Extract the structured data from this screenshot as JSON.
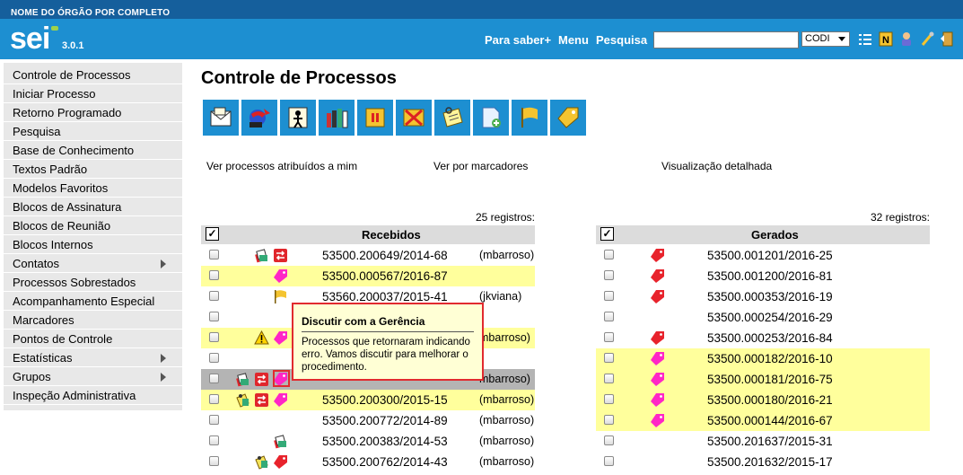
{
  "org_name": "NOME DO ÓRGÃO POR COMPLETO",
  "header": {
    "logo": "sei",
    "version": "3.0.1",
    "links": [
      "Para saber+",
      "Menu",
      "Pesquisa"
    ],
    "search_value": "",
    "org_select": "CODI",
    "icons": [
      "list-icon",
      "notes-icon",
      "user-icon",
      "tools-icon",
      "exit-icon"
    ]
  },
  "sidebar": {
    "items": [
      {
        "label": "Controle de Processos",
        "submenu": false
      },
      {
        "label": "Iniciar Processo",
        "submenu": false
      },
      {
        "label": "Retorno Programado",
        "submenu": false
      },
      {
        "label": "Pesquisa",
        "submenu": false
      },
      {
        "label": "Base de Conhecimento",
        "submenu": false
      },
      {
        "label": "Textos Padrão",
        "submenu": false
      },
      {
        "label": "Modelos Favoritos",
        "submenu": false
      },
      {
        "label": "Blocos de Assinatura",
        "submenu": false
      },
      {
        "label": "Blocos de Reunião",
        "submenu": false
      },
      {
        "label": "Blocos Internos",
        "submenu": false
      },
      {
        "label": "Contatos",
        "submenu": true
      },
      {
        "label": "Processos Sobrestados",
        "submenu": false
      },
      {
        "label": "Acompanhamento Especial",
        "submenu": false
      },
      {
        "label": "Marcadores",
        "submenu": false
      },
      {
        "label": "Pontos de Controle",
        "submenu": false
      },
      {
        "label": "Estatísticas",
        "submenu": true
      },
      {
        "label": "Grupos",
        "submenu": true
      },
      {
        "label": "Inspeção Administrativa",
        "submenu": false
      }
    ]
  },
  "main": {
    "title": "Controle de Processos",
    "toolbar": [
      "send-process-icon",
      "update-processes-icon",
      "assign-process-icon",
      "documents-icon",
      "suspend-icon",
      "conclude-icon",
      "annotation-icon",
      "new-document-icon",
      "flag-icon",
      "marker-icon"
    ],
    "view_links": [
      "Ver processos atribuídos a mim",
      "Ver por marcadores",
      "Visualização detalhada"
    ],
    "received": {
      "count": "25 registros:",
      "header": "Recebidos",
      "rows": [
        {
          "process": "53500.200649/2014-68",
          "user": "(mbarroso)",
          "icons": [
            "docs-icon",
            "transfer-icon"
          ],
          "highlight": false
        },
        {
          "process": "53500.000567/2016-87",
          "user": "",
          "icons": [
            "pink-tag-icon"
          ],
          "highlight": true
        },
        {
          "process": "53560.200037/2015-41",
          "user": "(jkviana)",
          "icons": [
            "yellow-flag-icon"
          ],
          "highlight": false
        },
        {
          "process": "",
          "user": "",
          "icons": [],
          "highlight": false
        },
        {
          "process": "",
          "user": "mbarroso)",
          "icons": [
            "warning-icon",
            "pink-tag-icon"
          ],
          "highlight": true
        },
        {
          "process": "",
          "user": "",
          "icons": [],
          "highlight": false
        },
        {
          "process": "",
          "user": "mbarroso)",
          "icons": [
            "docs-icon",
            "transfer-icon",
            "pink-tag-icon"
          ],
          "highlight": false,
          "selected": true
        },
        {
          "process": "53500.200300/2015-15",
          "user": "(mbarroso)",
          "icons": [
            "clipboard-icon",
            "transfer-icon",
            "pink-tag-icon"
          ],
          "highlight": true
        },
        {
          "process": "53500.200772/2014-89",
          "user": "(mbarroso)",
          "icons": [],
          "highlight": false
        },
        {
          "process": "53500.200383/2014-53",
          "user": "(mbarroso)",
          "icons": [
            "docs-icon"
          ],
          "highlight": false
        },
        {
          "process": "53500.200762/2014-43",
          "user": "(mbarroso)",
          "icons": [
            "clipboard-icon",
            "red-tag-icon"
          ],
          "highlight": false
        }
      ]
    },
    "generated": {
      "count": "32 registros:",
      "header": "Gerados",
      "rows": [
        {
          "process": "53500.001201/2016-25",
          "icons": [
            "red-tag-icon"
          ],
          "highlight": false
        },
        {
          "process": "53500.001200/2016-81",
          "icons": [
            "red-tag-icon"
          ],
          "highlight": false
        },
        {
          "process": "53500.000353/2016-19",
          "icons": [
            "red-tag-icon"
          ],
          "highlight": false
        },
        {
          "process": "53500.000254/2016-29",
          "icons": [],
          "highlight": false
        },
        {
          "process": "53500.000253/2016-84",
          "icons": [
            "red-tag-icon"
          ],
          "highlight": false
        },
        {
          "process": "53500.000182/2016-10",
          "icons": [
            "pink-tag-icon"
          ],
          "highlight": true
        },
        {
          "process": "53500.000181/2016-75",
          "icons": [
            "pink-tag-icon"
          ],
          "highlight": true
        },
        {
          "process": "53500.000180/2016-21",
          "icons": [
            "pink-tag-icon"
          ],
          "highlight": true
        },
        {
          "process": "53500.000144/2016-67",
          "icons": [
            "pink-tag-icon"
          ],
          "highlight": true
        },
        {
          "process": "53500.201637/2015-31",
          "icons": [],
          "highlight": false
        },
        {
          "process": "53500.201632/2015-17",
          "icons": [],
          "highlight": false
        }
      ]
    },
    "tooltip": {
      "title": "Discutir com a Gerência",
      "body": "Processos que retornaram indicando erro. Vamos discutir para melhorar o procedimento."
    }
  },
  "colors": {
    "header_blue": "#1d8fd1",
    "top_bar": "#155f9c",
    "highlight": "#ffff9c",
    "tag_pink": "#ff26c6",
    "tag_red": "#e8232c",
    "tooltip_border": "#e12a2f"
  }
}
